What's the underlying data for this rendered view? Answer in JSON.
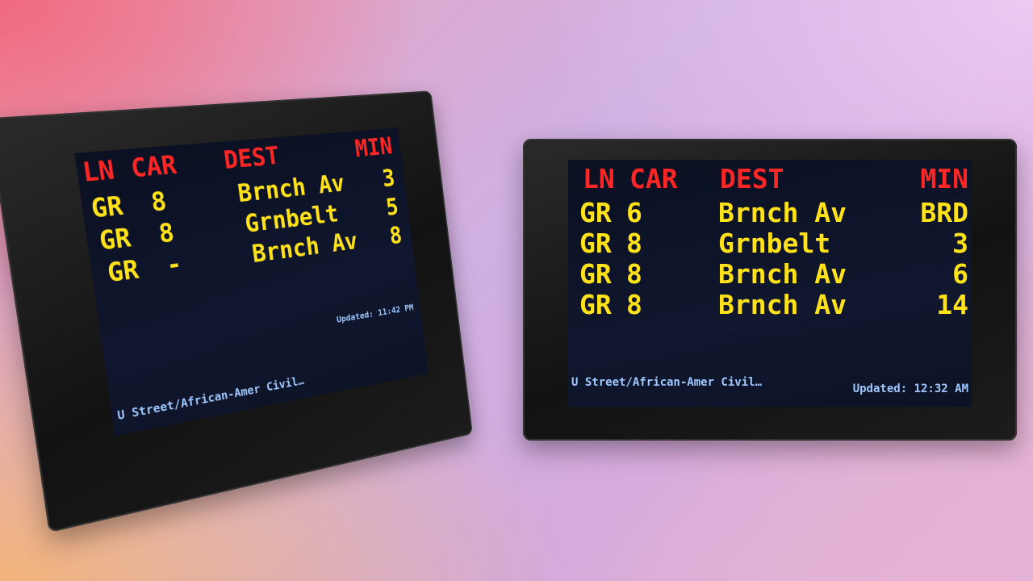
{
  "left_display": {
    "headers": {
      "ln": "LN",
      "car": "CAR",
      "dest": "DEST",
      "min": "MIN"
    },
    "rows": [
      {
        "ln": "GR",
        "car": "8",
        "dest": "Brnch Av",
        "min": "3"
      },
      {
        "ln": "GR",
        "car": "8",
        "dest": "Grnbelt",
        "min": "5"
      },
      {
        "ln": "GR",
        "car": "-",
        "dest": "Brnch Av",
        "min": "8"
      }
    ],
    "station": "U Street/African-Amer Civil…",
    "updated": "Updated: 11:42 PM"
  },
  "right_display": {
    "headers": {
      "ln": "LN",
      "car": "CAR",
      "dest": "DEST",
      "min": "MIN"
    },
    "rows": [
      {
        "ln": "GR",
        "car": "6",
        "dest": "Brnch Av",
        "min": "BRD"
      },
      {
        "ln": "GR",
        "car": "8",
        "dest": "Grnbelt",
        "min": "3"
      },
      {
        "ln": "GR",
        "car": "8",
        "dest": "Brnch Av",
        "min": "6"
      },
      {
        "ln": "GR",
        "car": "8",
        "dest": "Brnch Av",
        "min": "14"
      }
    ],
    "station": "U Street/African-Amer Civil…",
    "updated": "Updated: 12:32 AM"
  },
  "colors": {
    "header": "#ff2626",
    "value": "#ffe21a",
    "footer": "#9fc8ff",
    "screen": "#0b1022"
  }
}
